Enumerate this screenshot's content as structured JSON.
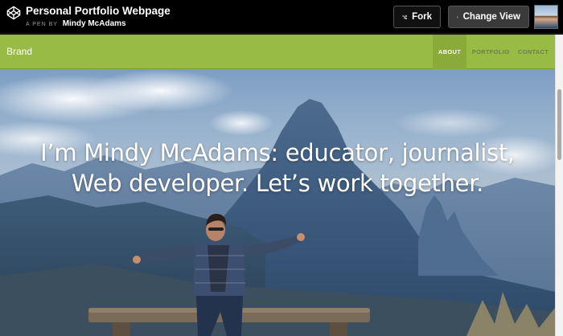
{
  "codepen": {
    "title": "Personal Portfolio Webpage",
    "byline_prefix": "A PEN BY",
    "author": "Mindy McAdams",
    "fork_label": "Fork",
    "change_view_label": "Change View",
    "icons": {
      "logo": "codepen-logo-icon",
      "fork": "fork-icon",
      "view": "layout-icon",
      "avatar": "user-avatar"
    }
  },
  "site": {
    "brand": "Brand",
    "nav": [
      {
        "label": "ABOUT",
        "active": true
      },
      {
        "label": "PORTFOLIO",
        "active": false
      },
      {
        "label": "CONTACT",
        "active": false
      }
    ],
    "headline": "I’m Mindy McAdams: educator, journalist, Web developer. Let’s work together."
  },
  "colors": {
    "navbar": "#98bb46",
    "nav_active": "#8aab3a",
    "topbar": "#000000"
  }
}
